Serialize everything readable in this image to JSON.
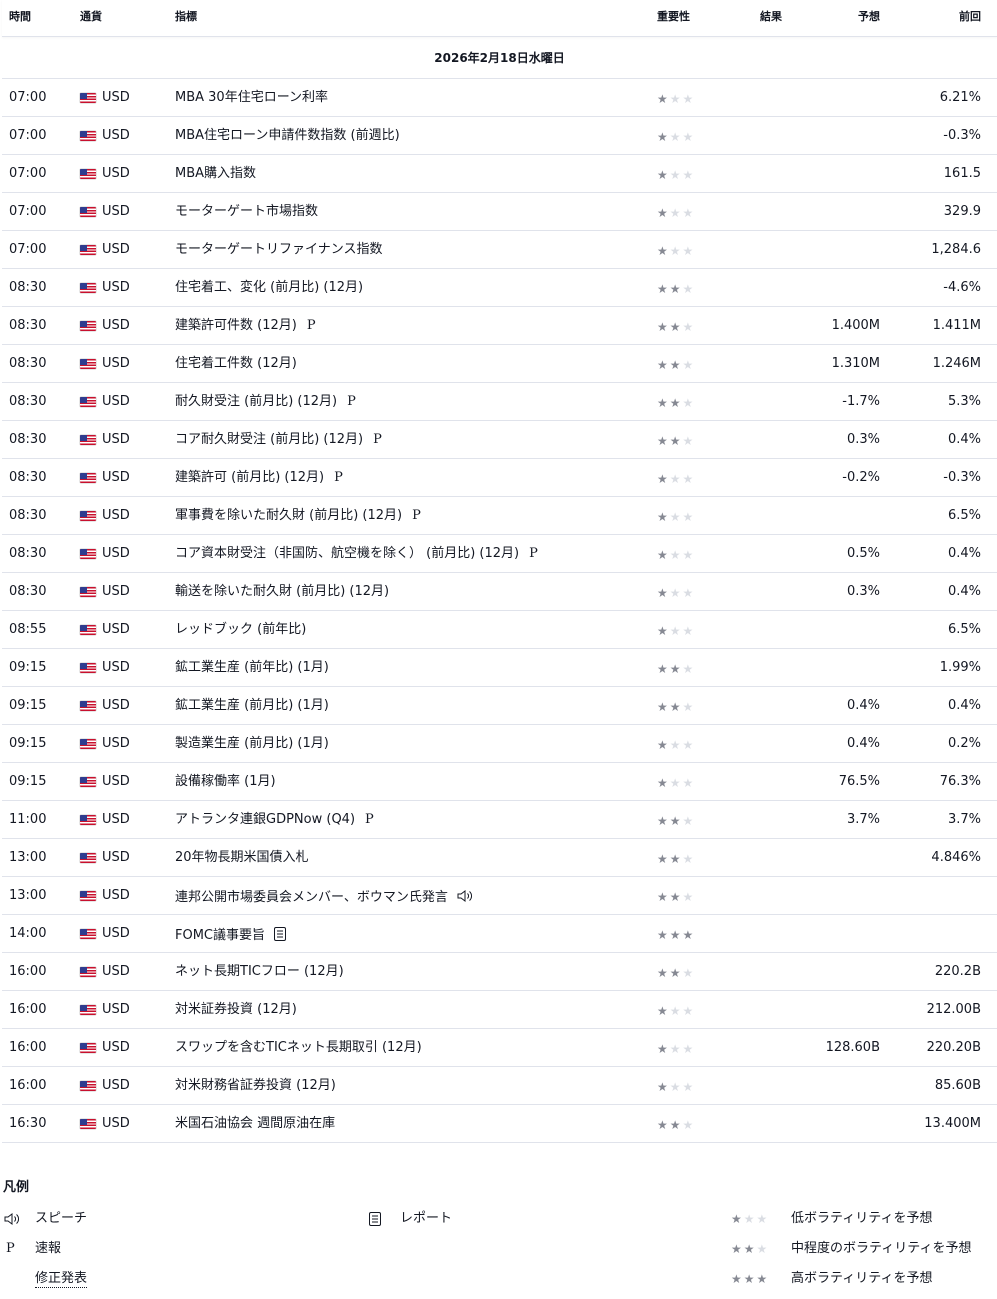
{
  "header": {
    "time": "時間",
    "currency": "通貨",
    "indicator": "指標",
    "importance": "重要性",
    "actual": "結果",
    "forecast": "予想",
    "previous": "前回"
  },
  "date_label": "2026年2月18日水曜日",
  "rows": [
    {
      "time": "07:00",
      "currency": "USD",
      "indicator": "MBA 30年住宅ローン利率",
      "mark": "",
      "icon": "",
      "stars": 1,
      "actual": "",
      "forecast": "",
      "previous": "6.21%"
    },
    {
      "time": "07:00",
      "currency": "USD",
      "indicator": "MBA住宅ローン申請件数指数 (前週比)",
      "mark": "",
      "icon": "",
      "stars": 1,
      "actual": "",
      "forecast": "",
      "previous": "-0.3%"
    },
    {
      "time": "07:00",
      "currency": "USD",
      "indicator": "MBA購入指数",
      "mark": "",
      "icon": "",
      "stars": 1,
      "actual": "",
      "forecast": "",
      "previous": "161.5"
    },
    {
      "time": "07:00",
      "currency": "USD",
      "indicator": "モーターゲート市場指数",
      "mark": "",
      "icon": "",
      "stars": 1,
      "actual": "",
      "forecast": "",
      "previous": "329.9"
    },
    {
      "time": "07:00",
      "currency": "USD",
      "indicator": "モーターゲートリファイナンス指数",
      "mark": "",
      "icon": "",
      "stars": 1,
      "actual": "",
      "forecast": "",
      "previous": "1,284.6"
    },
    {
      "time": "08:30",
      "currency": "USD",
      "indicator": "住宅着工、変化 (前月比) (12月)",
      "mark": "",
      "icon": "",
      "stars": 2,
      "actual": "",
      "forecast": "",
      "previous": "-4.6%"
    },
    {
      "time": "08:30",
      "currency": "USD",
      "indicator": "建築許可件数 (12月)",
      "mark": "P",
      "icon": "",
      "stars": 2,
      "actual": "",
      "forecast": "1.400M",
      "previous": "1.411M"
    },
    {
      "time": "08:30",
      "currency": "USD",
      "indicator": "住宅着工件数 (12月)",
      "mark": "",
      "icon": "",
      "stars": 2,
      "actual": "",
      "forecast": "1.310M",
      "previous": "1.246M"
    },
    {
      "time": "08:30",
      "currency": "USD",
      "indicator": "耐久財受注 (前月比) (12月)",
      "mark": "P",
      "icon": "",
      "stars": 2,
      "actual": "",
      "forecast": "-1.7%",
      "previous": "5.3%"
    },
    {
      "time": "08:30",
      "currency": "USD",
      "indicator": "コア耐久財受注 (前月比) (12月)",
      "mark": "P",
      "icon": "",
      "stars": 2,
      "actual": "",
      "forecast": "0.3%",
      "previous": "0.4%"
    },
    {
      "time": "08:30",
      "currency": "USD",
      "indicator": "建築許可 (前月比) (12月)",
      "mark": "P",
      "icon": "",
      "stars": 1,
      "actual": "",
      "forecast": "-0.2%",
      "previous": "-0.3%"
    },
    {
      "time": "08:30",
      "currency": "USD",
      "indicator": "軍事費を除いた耐久財 (前月比) (12月)",
      "mark": "P",
      "icon": "",
      "stars": 1,
      "actual": "",
      "forecast": "",
      "previous": "6.5%"
    },
    {
      "time": "08:30",
      "currency": "USD",
      "indicator": "コア資本財受注（非国防、航空機を除く） (前月比) (12月)",
      "mark": "P",
      "icon": "",
      "stars": 1,
      "actual": "",
      "forecast": "0.5%",
      "previous": "0.4%"
    },
    {
      "time": "08:30",
      "currency": "USD",
      "indicator": "輸送を除いた耐久財 (前月比) (12月)",
      "mark": "",
      "icon": "",
      "stars": 1,
      "actual": "",
      "forecast": "0.3%",
      "previous": "0.4%"
    },
    {
      "time": "08:55",
      "currency": "USD",
      "indicator": "レッドブック (前年比)",
      "mark": "",
      "icon": "",
      "stars": 1,
      "actual": "",
      "forecast": "",
      "previous": "6.5%"
    },
    {
      "time": "09:15",
      "currency": "USD",
      "indicator": "鉱工業生産 (前年比) (1月)",
      "mark": "",
      "icon": "",
      "stars": 2,
      "actual": "",
      "forecast": "",
      "previous": "1.99%"
    },
    {
      "time": "09:15",
      "currency": "USD",
      "indicator": "鉱工業生産 (前月比) (1月)",
      "mark": "",
      "icon": "",
      "stars": 2,
      "actual": "",
      "forecast": "0.4%",
      "previous": "0.4%"
    },
    {
      "time": "09:15",
      "currency": "USD",
      "indicator": "製造業生産 (前月比) (1月)",
      "mark": "",
      "icon": "",
      "stars": 1,
      "actual": "",
      "forecast": "0.4%",
      "previous": "0.2%"
    },
    {
      "time": "09:15",
      "currency": "USD",
      "indicator": "設備稼働率 (1月)",
      "mark": "",
      "icon": "",
      "stars": 1,
      "actual": "",
      "forecast": "76.5%",
      "previous": "76.3%"
    },
    {
      "time": "11:00",
      "currency": "USD",
      "indicator": "アトランタ連銀GDPNow (Q4)",
      "mark": "P",
      "icon": "",
      "stars": 2,
      "actual": "",
      "forecast": "3.7%",
      "previous": "3.7%"
    },
    {
      "time": "13:00",
      "currency": "USD",
      "indicator": "20年物長期米国債入札",
      "mark": "",
      "icon": "",
      "stars": 2,
      "actual": "",
      "forecast": "",
      "previous": "4.846%"
    },
    {
      "time": "13:00",
      "currency": "USD",
      "indicator": "連邦公開市場委員会メンバー、ボウマン氏発言",
      "mark": "",
      "icon": "speech-icon",
      "stars": 2,
      "actual": "",
      "forecast": "",
      "previous": ""
    },
    {
      "time": "14:00",
      "currency": "USD",
      "indicator": "FOMC議事要旨",
      "mark": "",
      "icon": "report-icon",
      "stars": 3,
      "actual": "",
      "forecast": "",
      "previous": ""
    },
    {
      "time": "16:00",
      "currency": "USD",
      "indicator": "ネット長期TICフロー (12月)",
      "mark": "",
      "icon": "",
      "stars": 2,
      "actual": "",
      "forecast": "",
      "previous": "220.2B"
    },
    {
      "time": "16:00",
      "currency": "USD",
      "indicator": "対米証券投資 (12月)",
      "mark": "",
      "icon": "",
      "stars": 1,
      "actual": "",
      "forecast": "",
      "previous": "212.00B"
    },
    {
      "time": "16:00",
      "currency": "USD",
      "indicator": "スワップを含むTICネット長期取引 (12月)",
      "mark": "",
      "icon": "",
      "stars": 1,
      "actual": "",
      "forecast": "128.60B",
      "previous": "220.20B"
    },
    {
      "time": "16:00",
      "currency": "USD",
      "indicator": "対米財務省証券投資 (12月)",
      "mark": "",
      "icon": "",
      "stars": 1,
      "actual": "",
      "forecast": "",
      "previous": "85.60B"
    },
    {
      "time": "16:30",
      "currency": "USD",
      "indicator": "米国石油協会 週間原油在庫",
      "mark": "",
      "icon": "",
      "stars": 2,
      "actual": "",
      "forecast": "",
      "previous": "13.400M"
    }
  ],
  "legend": {
    "title": "凡例",
    "speech": "スピーチ",
    "report": "レポート",
    "preliminary_mark": "P",
    "preliminary": "速報",
    "revised": "修正発表",
    "low": "低ボラティリティを予想",
    "medium": "中程度のボラティリティを予想",
    "high": "高ボラティリティを予想"
  },
  "colors": {
    "star_on": "#868993",
    "star_off": "#dadde3",
    "divider": "#e0e3eb",
    "text": "#131722"
  }
}
